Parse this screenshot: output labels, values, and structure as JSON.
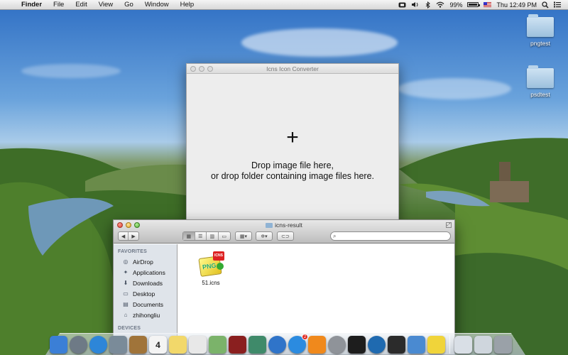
{
  "menubar": {
    "app_name": "Finder",
    "items": [
      "File",
      "Edit",
      "View",
      "Go",
      "Window",
      "Help"
    ],
    "battery_percent": "99%",
    "battery_level": 0.99,
    "clock": "Thu 12:49 PM"
  },
  "desktop": {
    "icons": [
      {
        "label": "pngtest"
      },
      {
        "label": "psdtest"
      }
    ]
  },
  "converter_window": {
    "title": "Icns Icon Converter",
    "plus": "+",
    "line1": "Drop image file here,",
    "line2": "or drop folder containing image files here."
  },
  "finder_window": {
    "title": "icns-result",
    "search_placeholder": "",
    "sidebar": {
      "favorites_header": "FAVORITES",
      "favorites": [
        {
          "label": "AirDrop",
          "icon": "airdrop-icon"
        },
        {
          "label": "Applications",
          "icon": "applications-icon"
        },
        {
          "label": "Downloads",
          "icon": "downloads-icon"
        },
        {
          "label": "Desktop",
          "icon": "desktop-icon"
        },
        {
          "label": "Documents",
          "icon": "documents-icon"
        },
        {
          "label": "zhihongliu",
          "icon": "home-icon"
        }
      ],
      "devices_header": "DEVICES"
    },
    "files": [
      {
        "label": "51.icns",
        "badge": "ICNS",
        "icon_text": "PNG"
      }
    ]
  },
  "dock": {
    "items": [
      {
        "name": "finder",
        "color": "#3b7fd6"
      },
      {
        "name": "launchpad",
        "color": "#6e7a86"
      },
      {
        "name": "safari",
        "color": "#2d86d8"
      },
      {
        "name": "mail",
        "color": "#7a8b99"
      },
      {
        "name": "contacts",
        "color": "#a0743a"
      },
      {
        "name": "calendar",
        "color": "#f4f4f4",
        "text": "4"
      },
      {
        "name": "notes",
        "color": "#f2d86a"
      },
      {
        "name": "reminders",
        "color": "#e8e8e8"
      },
      {
        "name": "maps",
        "color": "#7bb36a"
      },
      {
        "name": "photo-booth",
        "color": "#8a1f1f"
      },
      {
        "name": "iphoto",
        "color": "#3f8a6a"
      },
      {
        "name": "itunes",
        "color": "#2f74c9"
      },
      {
        "name": "app-store",
        "color": "#2b8be0",
        "badge": "2"
      },
      {
        "name": "ibooks",
        "color": "#f0891c"
      },
      {
        "name": "system-preferences",
        "color": "#8f9399"
      },
      {
        "name": "terminal",
        "color": "#1d1d1d"
      },
      {
        "name": "mission-control",
        "color": "#1f6ab0"
      },
      {
        "name": "activity-monitor",
        "color": "#2b2b2b"
      },
      {
        "name": "xcode",
        "color": "#4a8ad1"
      },
      {
        "name": "icns-converter",
        "color": "#f0d43a"
      },
      {
        "name": "downloads-stack",
        "color": "#d9dfe6"
      },
      {
        "name": "documents-stack",
        "color": "#cfd6dd"
      },
      {
        "name": "trash",
        "color": "#9aa1a8"
      }
    ]
  }
}
